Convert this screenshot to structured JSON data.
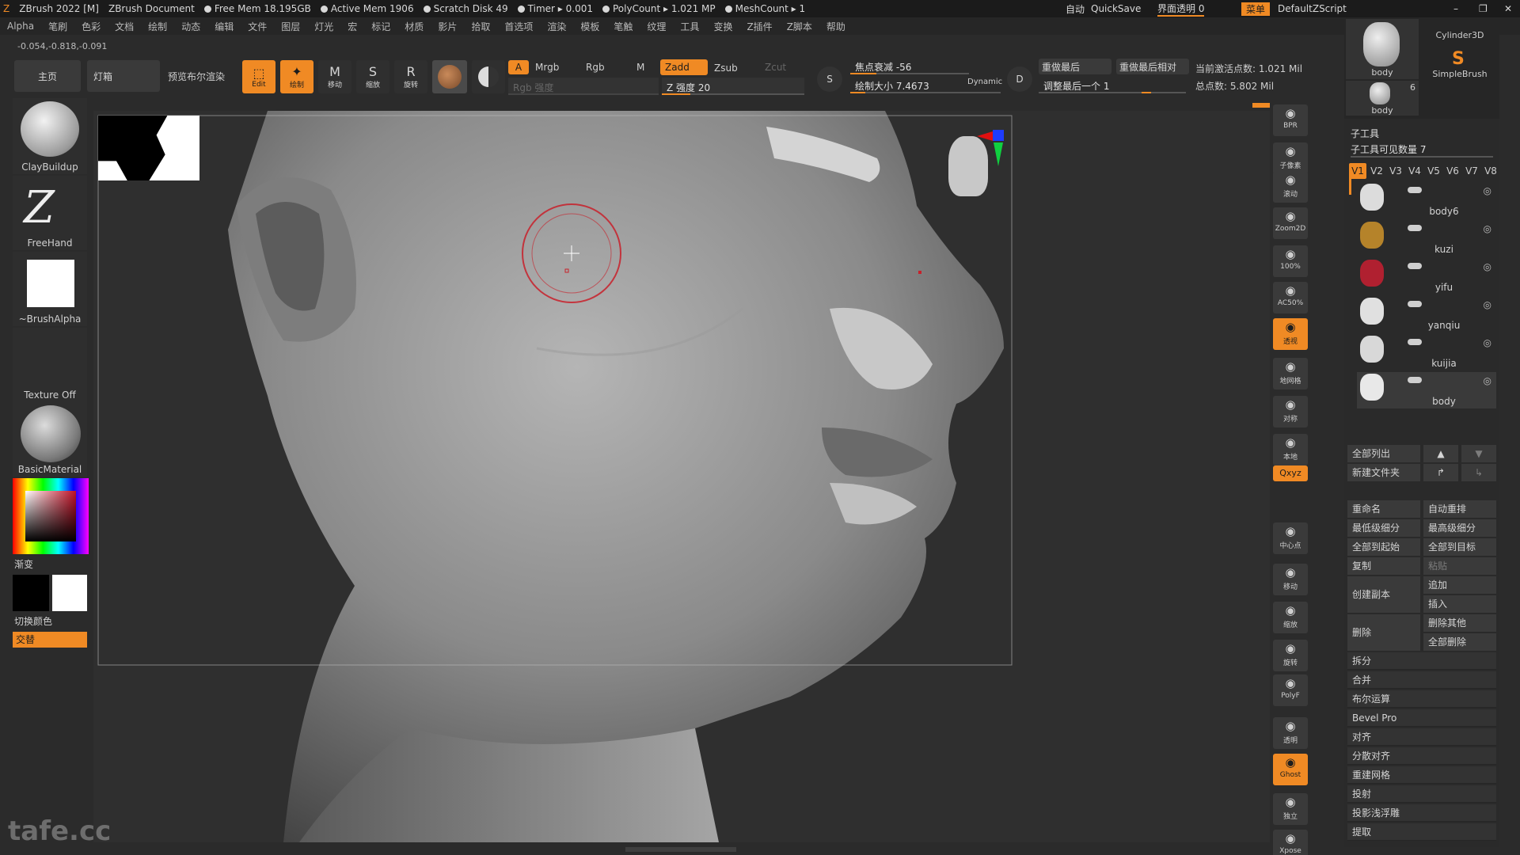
{
  "titlebar": {
    "app": "ZBrush 2022 [M]",
    "document": "ZBrush Document",
    "free_mem": "Free Mem 18.195GB",
    "active_mem": "Active Mem 1906",
    "scratch_disk": "Scratch Disk 49",
    "timer": "Timer ▸ 0.001",
    "polycount": "PolyCount ▸ 1.021 MP",
    "meshcount": "MeshCount ▸ 1",
    "auto": "自动",
    "quicksave": "QuickSave",
    "transparency": "界面透明 0",
    "menu": "菜单",
    "script": "DefaultZScript"
  },
  "menubar": [
    "Alpha",
    "笔刷",
    "色彩",
    "文档",
    "绘制",
    "动态",
    "编辑",
    "文件",
    "图层",
    "灯光",
    "宏",
    "标记",
    "材质",
    "影片",
    "拾取",
    "首选项",
    "渲染",
    "模板",
    "笔触",
    "纹理",
    "工具",
    "变换",
    "Z插件",
    "Z脚本",
    "帮助"
  ],
  "coords": "-0.054,-0.818,-0.091",
  "toolbar": {
    "home": "主页",
    "lightbox": "灯箱",
    "bool_preview": "预览布尔渲染",
    "edit": "Edit",
    "draw": "绘制",
    "move": "移动",
    "scale": "缩放",
    "rotate": "旋转",
    "a_label": "A",
    "mrgb": "Mrgb",
    "rgb": "Rgb",
    "m": "M",
    "zadd": "Zadd",
    "zsub": "Zsub",
    "zcut": "Zcut",
    "rgb_intensity": "Rgb 强度",
    "z_intensity": "Z 强度 20",
    "z_intensity_level": 0.2,
    "focal_shift": "焦点衰减 -56",
    "focal_shift_level": 0.22,
    "draw_size": "绘制大小 7.4673",
    "draw_size_level": 0.1,
    "dynamic": "Dynamic",
    "s_label": "S",
    "d_label": "D",
    "replay_last": "重做最后",
    "replay_last_rel": "重做最后相对",
    "adjust_last": "调整最后一个 1",
    "active_points": "当前激活点数: 1.021 Mil",
    "total_points": "总点数: 5.802 Mil"
  },
  "shelf": {
    "brush": "ClayBuildup",
    "stroke": "FreeHand",
    "alpha": "~BrushAlpha",
    "texture": "Texture Off",
    "material": "BasicMaterial",
    "gradient": "渐变",
    "switch_color": "切换颜色",
    "alternate": "交替"
  },
  "righttray": [
    {
      "name": "bpr",
      "label": "BPR"
    },
    {
      "name": "subpixel",
      "label": "子像素"
    },
    {
      "name": "scroll",
      "label": "滚动"
    },
    {
      "name": "zoom2d",
      "label": "Zoom2D"
    },
    {
      "name": "zoom100",
      "label": "100%"
    },
    {
      "name": "ac50",
      "label": "AC50%"
    },
    {
      "name": "perspective",
      "label": "透视"
    },
    {
      "name": "floor",
      "label": "地网格"
    },
    {
      "name": "symmetry",
      "label": "对称"
    },
    {
      "name": "local",
      "label": "本地"
    },
    {
      "name": "xyz",
      "label": "Qxyz"
    },
    {
      "name": "frame",
      "label": "中心点"
    },
    {
      "name": "move",
      "label": "移动"
    },
    {
      "name": "zoom",
      "label": "缩放"
    },
    {
      "name": "rotate",
      "label": "旋转"
    },
    {
      "name": "polyf",
      "label": "PolyF"
    },
    {
      "name": "transp",
      "label": "透明"
    },
    {
      "name": "ghost",
      "label": "Ghost"
    },
    {
      "name": "solo",
      "label": "独立"
    },
    {
      "name": "xpose",
      "label": "Xpose"
    }
  ],
  "rightpanel": {
    "cylinder": "Cylinder3D",
    "simplebrush": "SimpleBrush",
    "body_top": "body",
    "body_count": "6",
    "body_small": "body",
    "subtool_title": "子工具",
    "visible_count": "子工具可见数量 7",
    "versions": [
      "V1",
      "V2",
      "V3",
      "V4",
      "V5",
      "V6",
      "V7",
      "V8"
    ],
    "subtools": [
      "body6",
      "kuzi",
      "yifu",
      "yanqiu",
      "kuijia",
      "body"
    ],
    "list_all": "全部列出",
    "new_folder": "新建文件夹",
    "rename": "重命名",
    "auto_reorder": "自动重排",
    "lowest_sub": "最低级细分",
    "highest_sub": "最高级细分",
    "all_to_start": "全部到起始",
    "all_to_target": "全部到目标",
    "duplicate": "复制",
    "paste": "粘贴",
    "append": "追加",
    "insert": "插入",
    "create_copy": "创建副本",
    "delete": "删除",
    "delete_other": "删除其他",
    "delete_all": "全部删除",
    "split": "拆分",
    "merge": "合并",
    "boolean": "布尔运算",
    "bevel_pro": "Bevel Pro",
    "align": "对齐",
    "distribute": "分散对齐",
    "remesh": "重建网格",
    "project": "投射",
    "project_bas": "投影浅浮雕",
    "extract": "提取"
  },
  "watermark": "tafe.cc",
  "colors": {
    "accent": "#f08a24",
    "bg": "#2b2b2b"
  }
}
